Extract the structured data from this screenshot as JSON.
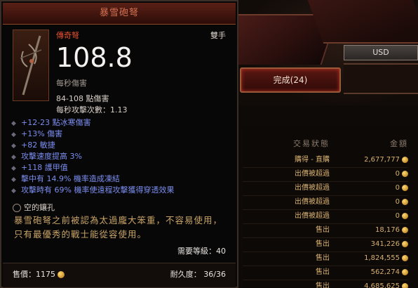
{
  "market": {
    "currency": "USD",
    "complete_tab": "完成(24)",
    "headers": {
      "status": "交易狀態",
      "amount": "金額"
    },
    "rows": [
      {
        "status": "購得 - 直購",
        "amount": "2,677,777"
      },
      {
        "status": "出價被超過",
        "amount": "0"
      },
      {
        "status": "出價被超過",
        "amount": "0"
      },
      {
        "status": "出價被超過",
        "amount": "0"
      },
      {
        "status": "出價被超過",
        "amount": "0"
      },
      {
        "status": "售出",
        "amount": "18,176"
      },
      {
        "status": "售出",
        "amount": "341,226"
      },
      {
        "status": "售出",
        "amount": "1,824,555"
      },
      {
        "status": "售出",
        "amount": "562,274"
      },
      {
        "status": "售出",
        "amount": "4,685,625"
      }
    ]
  },
  "item": {
    "name": "暴雪砲弩",
    "rarity": "傳奇弩",
    "hands": "雙手",
    "dps": "108.8",
    "dps_label": "每秒傷害",
    "damage_range": "84-108 點傷害",
    "attacks_per_second": "每秒攻擊次數：1.13",
    "affixes": [
      "+12-23 點冰寒傷害",
      "+13% 傷害",
      "+82 敏捷",
      "攻擊速度提高 3%",
      "+118 護甲值",
      "擊中有 14.9% 機率造成凍結",
      "攻擊時有 69% 機率使遠程攻擊獲得穿透效果"
    ],
    "socket": "空的鑲孔",
    "flavor": "暴雪砲弩之前被認為太過龐大笨重，不容易使用，只有最優秀的戰士能從容使用。",
    "required_level": "需要等級：40",
    "price": "售價：1175",
    "durability": "耐久度：  36/36"
  },
  "colors": {
    "legendary": "#e85030",
    "affix": "#7a8ef0",
    "flavor": "#c8a468",
    "gold": "#d8b070"
  }
}
